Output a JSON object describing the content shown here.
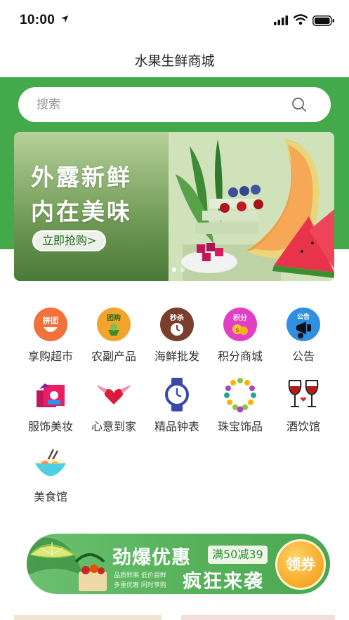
{
  "status_bar": {
    "time": "10:00"
  },
  "nav": {
    "title": "水果生鲜商城"
  },
  "search": {
    "placeholder": "搜索"
  },
  "banner": {
    "headline_line1": "外露新鲜",
    "headline_line2": "内在美味",
    "cta_label": "立即抢购>",
    "slide_count": 2,
    "active_slide": 1
  },
  "categories": [
    {
      "label": "享购超市",
      "icon": "group-buy-icon",
      "badge": "拼团"
    },
    {
      "label": "农副产品",
      "icon": "farm-products-icon",
      "badge": "团购"
    },
    {
      "label": "海鲜批发",
      "icon": "seckill-icon",
      "badge": "秒杀"
    },
    {
      "label": "积分商城",
      "icon": "points-icon",
      "badge": "积分"
    },
    {
      "label": "公告",
      "icon": "announcement-icon",
      "badge": "公告"
    },
    {
      "label": "服饰美妆",
      "icon": "clothing-icon"
    },
    {
      "label": "心意到家",
      "icon": "winged-heart-icon"
    },
    {
      "label": "精品钟表",
      "icon": "watch-icon"
    },
    {
      "label": "珠宝饰品",
      "icon": "necklace-icon"
    },
    {
      "label": "酒饮馆",
      "icon": "wine-glasses-icon"
    },
    {
      "label": "美食馆",
      "icon": "noodle-bowl-icon"
    }
  ],
  "coupon": {
    "title": "劲爆优惠",
    "tag": "满50减39",
    "sub1": "品质鲜果  低价尝鲜",
    "sub2": "多重优惠  同时享购",
    "big": "疯狂来袭",
    "button": "领券"
  },
  "colors": {
    "brand_green": "#43a94a",
    "coupon_orange": "#f7a825"
  }
}
